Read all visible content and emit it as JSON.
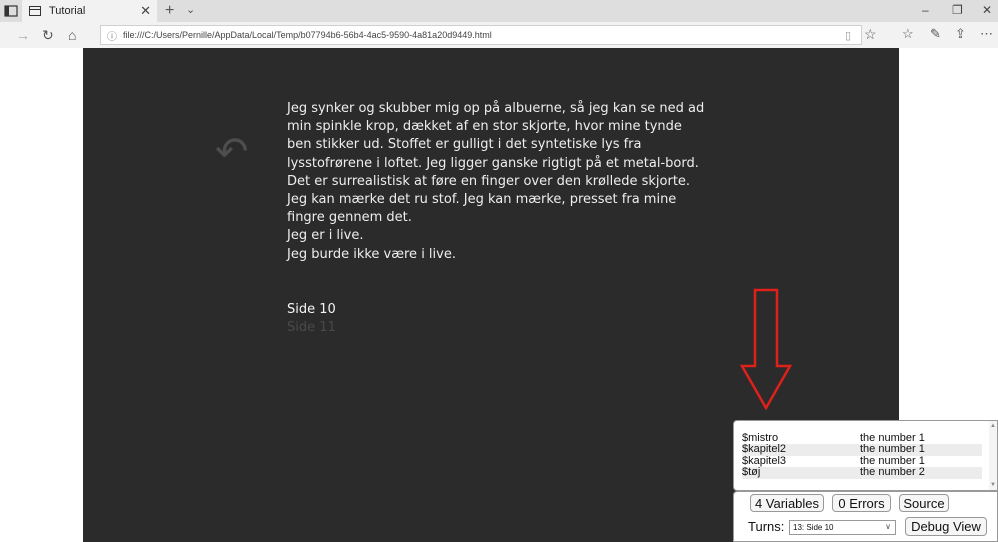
{
  "browser": {
    "tab_title": "Tutorial",
    "tab_close": "✕",
    "new_tab": "+",
    "tab_menu": "⌄",
    "window": {
      "minimize": "–",
      "restore": "❐",
      "close": "✕"
    },
    "url": "file:///C:/Users/Pernille/AppData/Local/Temp/b07794b6-56b4-4ac5-9590-4a81a20d9449.html",
    "icons": {
      "back": "→",
      "refresh": "↻",
      "home": "⌂",
      "info": "ⓘ",
      "reading_view": "▯",
      "favorite": "☆",
      "favorites_bar": "☆",
      "notes": "✎",
      "share": "⇪",
      "more": "⋯"
    }
  },
  "story": {
    "undo_icon": "↶",
    "paragraphs": [
      "Jeg synker og skubber mig op på albuerne, så jeg kan se ned ad min spinkle krop, dækket af en stor skjorte, hvor mine tynde ben stikker ud. Stoffet er gulligt i det syntetiske lys fra lysstofrørene i loftet. Jeg ligger ganske rigtigt på et metal-bord.",
      "Det er surrealistisk at føre en finger over den krøllede skjorte. Jeg kan mærke det ru stof. Jeg kan mærke, presset fra mine fingre gennem det.",
      "Jeg er i live.",
      "Jeg burde ikke være i live."
    ],
    "link_current": "Side 10",
    "link_next": "Side 11"
  },
  "debug": {
    "variables": [
      {
        "name": "$mistro",
        "value": "the number 1"
      },
      {
        "name": "$kapitel2",
        "value": "the number 1"
      },
      {
        "name": "$kapitel3",
        "value": "the number 1"
      },
      {
        "name": "$tøj",
        "value": "the number 2"
      }
    ],
    "variables_button": "4 Variables",
    "errors_button": "0 Errors",
    "source_button": "Source",
    "turns_label": "Turns:",
    "turns_selected": "13: Side 10",
    "debug_view_button": "Debug View"
  },
  "colors": {
    "story_bg": "#2b2b2b",
    "arrow": "#e0201b"
  }
}
